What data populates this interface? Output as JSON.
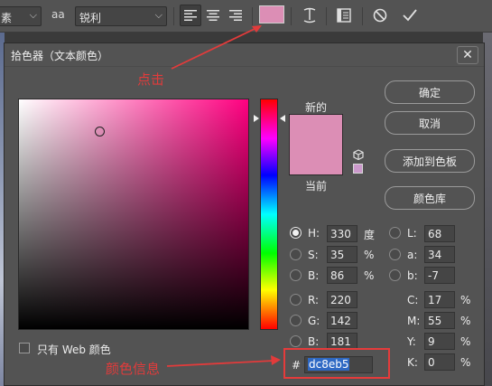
{
  "toolbar": {
    "font_style_partial": "素",
    "aa_icon_label": "aa",
    "antialias_value": "锐利",
    "text_color": "#dc8eb5"
  },
  "dialog": {
    "title": "拾色器（文本颜色）",
    "close_glyph": "✕",
    "new_label": "新的",
    "current_label": "当前",
    "new_color": "#dc8eb5",
    "current_color": "#dc8eb5",
    "buttons": {
      "ok": "确定",
      "cancel": "取消",
      "add_swatch": "添加到色板",
      "libraries": "颜色库"
    },
    "web_only_label": "只有 Web 颜色",
    "hsb": {
      "h_label": "H:",
      "h_value": "330",
      "h_unit": "度",
      "s_label": "S:",
      "s_value": "35",
      "s_unit": "%",
      "b_label": "B:",
      "b_value": "86",
      "b_unit": "%"
    },
    "rgb": {
      "r_label": "R:",
      "r_value": "220",
      "g_label": "G:",
      "g_value": "142",
      "b_label": "B:",
      "b_value": "181"
    },
    "lab": {
      "l_label": "L:",
      "l_value": "68",
      "a_label": "a:",
      "a_value": "34",
      "b_label": "b:",
      "b_value": "-7"
    },
    "cmyk": {
      "c_label": "C:",
      "c_value": "17",
      "c_unit": "%",
      "m_label": "M:",
      "m_value": "55",
      "m_unit": "%",
      "y_label": "Y:",
      "y_value": "9",
      "y_unit": "%",
      "k_label": "K:",
      "k_value": "0",
      "k_unit": "%"
    },
    "hex_label": "#",
    "hex_value": "dc8eb5"
  },
  "annotations": {
    "click": "点击",
    "color_info": "颜色信息",
    "color": "#e23b3b"
  }
}
